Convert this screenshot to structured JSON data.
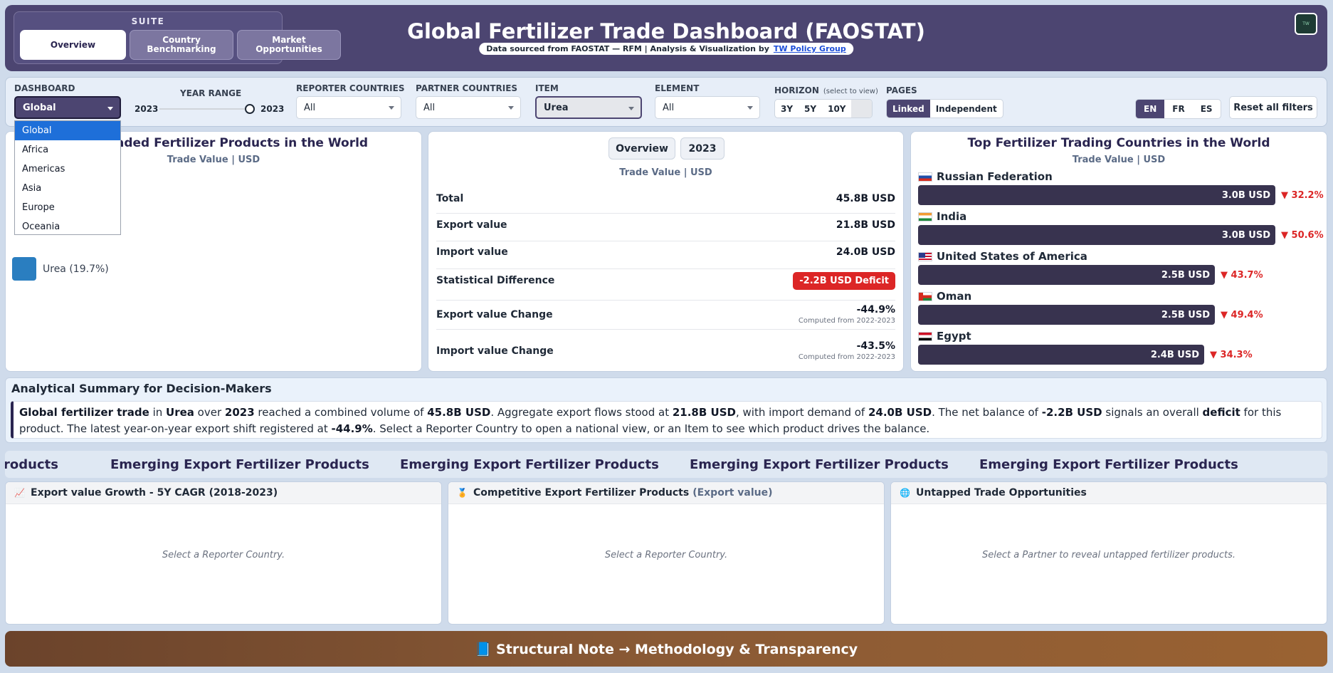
{
  "header": {
    "suite_label": "SUITE",
    "suite_tabs": [
      {
        "label": "Overview",
        "active": true
      },
      {
        "label": "Country Benchmarking",
        "active": false
      },
      {
        "label": "Market Opportunities",
        "active": false
      }
    ],
    "title": "Global Fertilizer Trade Dashboard (FAOSTAT)",
    "subtitle_text": "Data sourced from FAOSTAT — RFM | Analysis & Visualization by",
    "subtitle_link": "TW Policy Group",
    "logo_icon": "tw-logo-icon"
  },
  "filters": {
    "dashboard": {
      "label": "DASHBOARD",
      "value": "Global"
    },
    "year_range": {
      "label": "YEAR RANGE",
      "from": "2023",
      "to": "2023"
    },
    "reporter": {
      "label": "REPORTER COUNTRIES",
      "value": "All"
    },
    "partner": {
      "label": "PARTNER COUNTRIES",
      "value": "All"
    },
    "item": {
      "label": "ITEM",
      "value": "Urea"
    },
    "element": {
      "label": "ELEMENT",
      "value": "All"
    },
    "horizon": {
      "label": "HORIZON",
      "hint": "(select to view)",
      "options": [
        "3Y",
        "5Y",
        "10Y"
      ]
    },
    "pages": {
      "label": "PAGES",
      "options": [
        "Linked",
        "Independent"
      ],
      "active": "Linked"
    },
    "languages": {
      "options": [
        "EN",
        "FR",
        "ES"
      ],
      "active": "EN"
    },
    "reset_label": "Reset all filters"
  },
  "dashboard_dropdown": {
    "options": [
      "Global",
      "Africa",
      "Americas",
      "Asia",
      "Europe",
      "Oceania"
    ],
    "selected": "Global"
  },
  "products_panel": {
    "title": "aded Fertilizer Products in the World",
    "subtitle": "Trade Value | USD",
    "legend": {
      "label": "Urea (19.7%)",
      "color": "#2a7ec0"
    }
  },
  "kpi_panel": {
    "tabs": [
      "Overview",
      "2023"
    ],
    "subtitle": "Trade Value | USD",
    "rows": [
      {
        "key": "Total",
        "value": "45.8B USD"
      },
      {
        "key": "Export value",
        "value": "21.8B USD"
      },
      {
        "key": "Import value",
        "value": "24.0B USD"
      },
      {
        "key": "Statistical Difference",
        "value": "-2.2B USD Deficit"
      },
      {
        "key": "Export value Change",
        "value": "-44.9%",
        "note": "Computed from 2022-2023"
      },
      {
        "key": "Import value Change",
        "value": "-43.5%",
        "note": "Computed from 2022-2023"
      }
    ],
    "deficit_color": "#dc2626"
  },
  "top_countries": {
    "title": "Top Fertilizer Trading Countries in the World",
    "subtitle": "Trade Value | USD",
    "countries": [
      {
        "name": "Russian Federation",
        "value": "3.0B USD",
        "change": "▼ 32.2%",
        "share": 1.0
      },
      {
        "name": "India",
        "value": "3.0B USD",
        "change": "▼ 50.6%",
        "share": 1.0
      },
      {
        "name": "United States of America",
        "value": "2.5B USD",
        "change": "▼ 43.7%",
        "share": 0.83
      },
      {
        "name": "Oman",
        "value": "2.5B USD",
        "change": "▼ 49.4%",
        "share": 0.83
      },
      {
        "name": "Egypt",
        "value": "2.4B USD",
        "change": "▼ 34.3%",
        "share": 0.8
      }
    ]
  },
  "summary": {
    "title": "Analytical Summary for Decision-Makers",
    "parts": [
      {
        "text": "Global fertilizer trade",
        "bold": true
      },
      {
        "text": " in ",
        "bold": false
      },
      {
        "text": "Urea",
        "bold": true
      },
      {
        "text": " over ",
        "bold": false
      },
      {
        "text": "2023",
        "bold": true
      },
      {
        "text": " reached a combined volume of ",
        "bold": false
      },
      {
        "text": "45.8B USD",
        "bold": true
      },
      {
        "text": ". Aggregate export flows stood at ",
        "bold": false
      },
      {
        "text": "21.8B USD",
        "bold": true
      },
      {
        "text": ", with import demand of ",
        "bold": false
      },
      {
        "text": "24.0B USD",
        "bold": true
      },
      {
        "text": ". The net balance of ",
        "bold": false
      },
      {
        "text": "-2.2B USD",
        "bold": true
      },
      {
        "text": " signals an overall ",
        "bold": false
      },
      {
        "text": "deficit",
        "bold": true
      },
      {
        "text": " for this product. The latest year-on-year export shift registered at ",
        "bold": false
      },
      {
        "text": "-44.9%",
        "bold": true
      },
      {
        "text": ". Select a Reporter Country to open a national view, or an Item to see which product drives the balance.",
        "bold": false
      }
    ]
  },
  "marquee": {
    "items": [
      "roducts",
      "Emerging Export Fertilizer Products",
      "Emerging Export Fertilizer Products",
      "Emerging Export Fertilizer Products",
      "Emerging Export Fertilizer Products"
    ]
  },
  "bottom_panels": [
    {
      "icon": "📈",
      "title": "Export value Growth - 5Y CAGR (2018-2023)",
      "muted": "",
      "empty": "Select a Reporter Country."
    },
    {
      "icon": "🏅",
      "title": "Competitive Export Fertilizer Products",
      "muted": "(Export value)",
      "empty": "Select a Reporter Country."
    },
    {
      "icon": "🌐",
      "title": "Untapped Trade Opportunities",
      "muted": "",
      "empty": "Select a Partner to reveal untapped fertilizer products."
    }
  ],
  "footer": {
    "label": "📘 Structural Note → Methodology & Transparency"
  }
}
